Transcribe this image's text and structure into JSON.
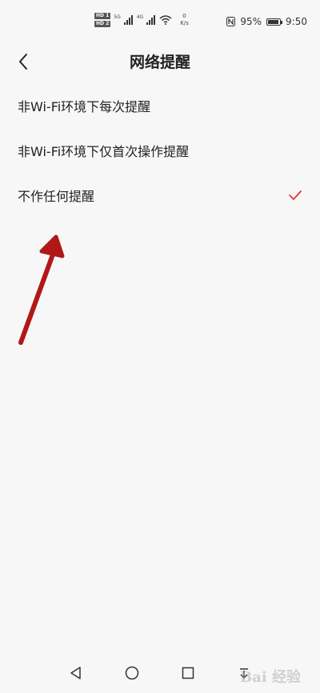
{
  "status_bar": {
    "hd_badge_1": "HD 1",
    "hd_badge_2": "HD 2",
    "net_type_1": "5G",
    "net_type_2": "4G",
    "speed_value": "0",
    "speed_unit": "K/s",
    "battery_percent": "95%",
    "battery_level": 0.95,
    "time": "9:50"
  },
  "header": {
    "title": "网络提醒"
  },
  "options": [
    {
      "label": "非Wi-Fi环境下每次提醒",
      "selected": false
    },
    {
      "label": "非Wi-Fi环境下仅首次操作提醒",
      "selected": false
    },
    {
      "label": "不作任何提醒",
      "selected": true
    }
  ],
  "colors": {
    "accent": "#e03a3a",
    "annotation_arrow": "#b01818",
    "background": "#f7f7f7"
  },
  "watermark": {
    "text": "Bai 经验"
  }
}
